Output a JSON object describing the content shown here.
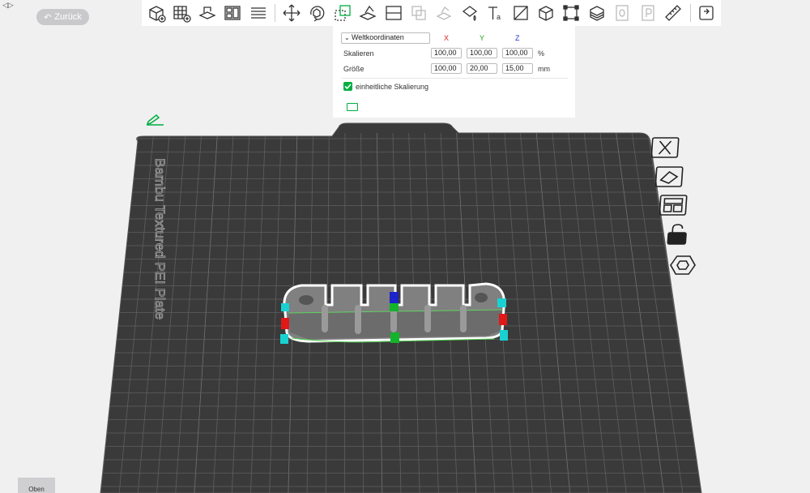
{
  "colors": {
    "accent": "#00ae42",
    "background": "#f0f0f1",
    "plate": "#3b3b3b",
    "axis_x": "#e02020",
    "axis_y": "#16a31a",
    "axis_z": "#2233cc"
  },
  "nav": {
    "back_label": "Zurück",
    "collapse_label": "◁▷"
  },
  "toolbar": {
    "icons": [
      "add-cube-icon",
      "grid-add-icon",
      "auto-orient-icon",
      "arrange-icon",
      "layers-icon",
      "move-icon",
      "rotate-icon",
      "scale-icon",
      "lay-on-face-icon",
      "cut-icon",
      "boolean-icon",
      "support-paint-icon",
      "seam-paint-icon",
      "text-icon",
      "assembly-icon",
      "measure-box-icon",
      "fuzzy-icon",
      "variable-layer-icon",
      "sla-o-icon",
      "sla-p-icon",
      "ruler-icon",
      "plate-return-icon"
    ]
  },
  "scale_panel": {
    "coord_system": "Weltkoordinaten",
    "axes": {
      "x": "X",
      "y": "Y",
      "z": "Z"
    },
    "scale": {
      "label": "Skalieren",
      "x": "100,00",
      "y": "100,00",
      "z": "100,00",
      "unit": "%"
    },
    "size": {
      "label": "Größe",
      "x": "100,00",
      "y": "20,00",
      "z": "15,00",
      "unit": "mm"
    },
    "uniform_scaling": {
      "label": "einheitliche Skalierung",
      "checked": true
    }
  },
  "plate": {
    "name": "Bambu Textured PEI Plate"
  },
  "plate_tools": [
    "close-icon",
    "auto-arrange-icon",
    "layout-icon",
    "lock-icon",
    "settings-hex-icon"
  ],
  "view": {
    "label": "Oben"
  }
}
